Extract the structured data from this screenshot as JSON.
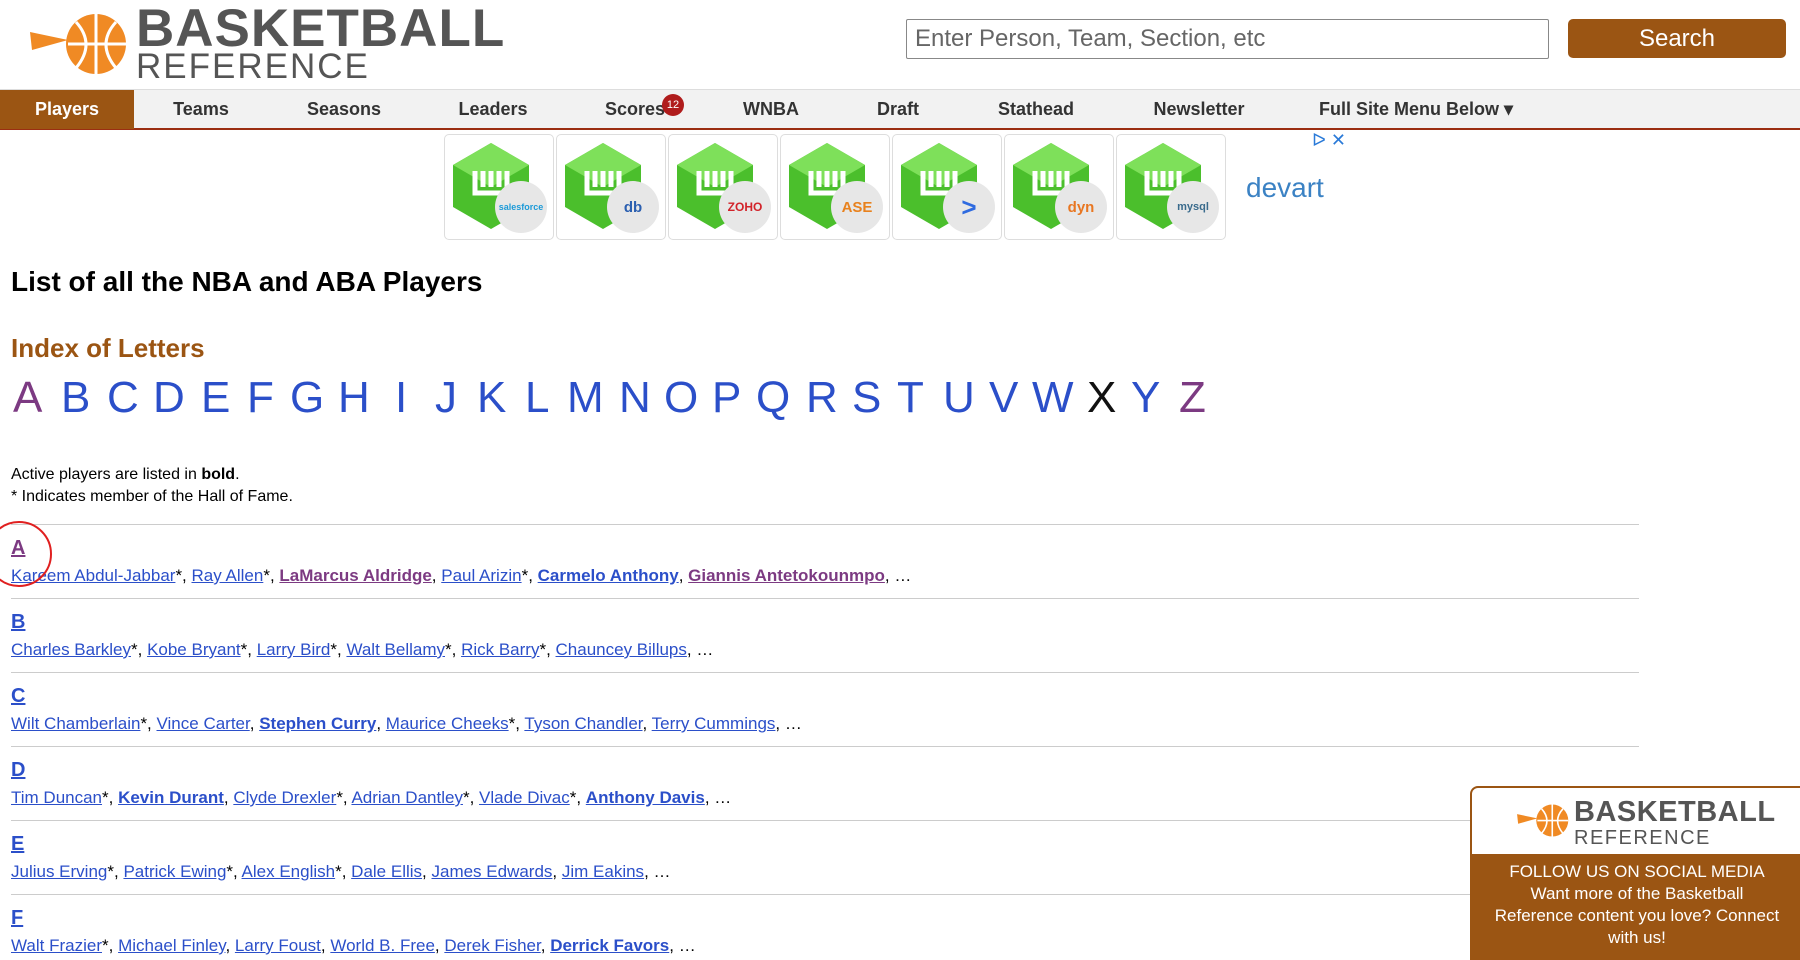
{
  "logo": {
    "line1": "BASKETBALL",
    "line2": "REFERENCE"
  },
  "search": {
    "placeholder": "Enter Person, Team, Section, etc",
    "button": "Search"
  },
  "nav": [
    {
      "label": "Players",
      "active": true
    },
    {
      "label": "Teams"
    },
    {
      "label": "Seasons"
    },
    {
      "label": "Leaders"
    },
    {
      "label": "Scores",
      "badge": "12"
    },
    {
      "label": "WNBA"
    },
    {
      "label": "Draft"
    },
    {
      "label": "Stathead"
    },
    {
      "label": "Newsletter"
    },
    {
      "label": "Full Site Menu Below ▾"
    }
  ],
  "ad": {
    "brand": "devart",
    "controls": "ᐅ ✕",
    "tiles": [
      "salesforce",
      "db",
      "ZOHO",
      "ASE",
      ">",
      "dyn",
      "mysql"
    ]
  },
  "page_title": "List of all the NBA and ABA Players",
  "index_title": "Index of Letters",
  "letters": [
    "A",
    "B",
    "C",
    "D",
    "E",
    "F",
    "G",
    "H",
    "I",
    "J",
    "K",
    "L",
    "M",
    "N",
    "O",
    "P",
    "Q",
    "R",
    "S",
    "T",
    "U",
    "V",
    "W",
    "X",
    "Y",
    "Z"
  ],
  "legend": {
    "line1_prefix": "Active players are listed in ",
    "line1_bold": "bold",
    "line1_suffix": ".",
    "line2": "* Indicates member of the Hall of Fame."
  },
  "sections": [
    {
      "letter": "A",
      "players": [
        {
          "name": "Kareem Abdul-Jabbar",
          "hof": true
        },
        {
          "name": "Ray Allen",
          "hof": true
        },
        {
          "name": "LaMarcus Aldridge",
          "active": true,
          "visited": true
        },
        {
          "name": "Paul Arizin",
          "hof": true
        },
        {
          "name": "Carmelo Anthony",
          "active": true
        },
        {
          "name": "Giannis Antetokounmpo",
          "active": true,
          "visited": true
        }
      ]
    },
    {
      "letter": "B",
      "players": [
        {
          "name": "Charles Barkley",
          "hof": true
        },
        {
          "name": "Kobe Bryant",
          "hof": true
        },
        {
          "name": "Larry Bird",
          "hof": true
        },
        {
          "name": "Walt Bellamy",
          "hof": true
        },
        {
          "name": "Rick Barry",
          "hof": true
        },
        {
          "name": "Chauncey Billups"
        }
      ]
    },
    {
      "letter": "C",
      "players": [
        {
          "name": "Wilt Chamberlain",
          "hof": true
        },
        {
          "name": "Vince Carter"
        },
        {
          "name": "Stephen Curry",
          "active": true
        },
        {
          "name": "Maurice Cheeks",
          "hof": true
        },
        {
          "name": "Tyson Chandler"
        },
        {
          "name": "Terry Cummings"
        }
      ]
    },
    {
      "letter": "D",
      "players": [
        {
          "name": "Tim Duncan",
          "hof": true
        },
        {
          "name": "Kevin Durant",
          "active": true
        },
        {
          "name": "Clyde Drexler",
          "hof": true
        },
        {
          "name": "Adrian Dantley",
          "hof": true
        },
        {
          "name": "Vlade Divac",
          "hof": true
        },
        {
          "name": "Anthony Davis",
          "active": true
        }
      ]
    },
    {
      "letter": "E",
      "players": [
        {
          "name": "Julius Erving",
          "hof": true
        },
        {
          "name": "Patrick Ewing",
          "hof": true
        },
        {
          "name": "Alex English",
          "hof": true
        },
        {
          "name": "Dale Ellis"
        },
        {
          "name": "James Edwards"
        },
        {
          "name": "Jim Eakins"
        }
      ]
    },
    {
      "letter": "F",
      "players": [
        {
          "name": "Walt Frazier",
          "hof": true
        },
        {
          "name": "Michael Finley"
        },
        {
          "name": "Larry Foust"
        },
        {
          "name": "World B. Free"
        },
        {
          "name": "Derek Fisher"
        },
        {
          "name": "Derrick Favors",
          "active": true
        }
      ]
    }
  ],
  "more": "…",
  "social": {
    "logo1": "BASKETBALL",
    "logo2": "REFERENCE",
    "line1": "FOLLOW US ON SOCIAL MEDIA",
    "line2": "Want more of the Basketball Reference content you love? Connect with us!"
  },
  "colors": {
    "brand": "#9b5513",
    "link": "#2b4fc9",
    "visited": "#7c3a82",
    "nav_border": "#9b2e12"
  }
}
